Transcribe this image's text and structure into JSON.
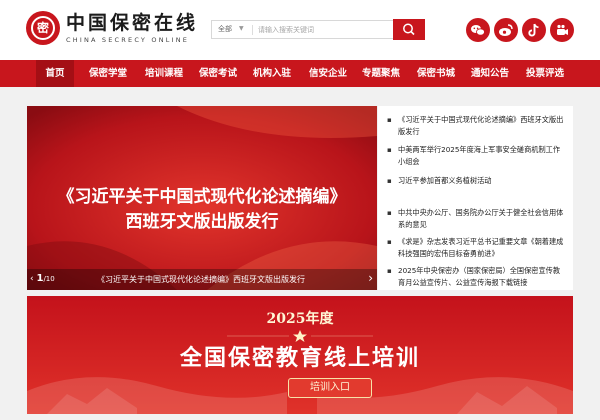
{
  "header": {
    "logo_cn": "中国保密在线",
    "logo_en": "CHINA SECRECY ONLINE",
    "logo_mark": "密",
    "search": {
      "scope": "全部",
      "placeholder": "请输入搜索关键词",
      "button_icon": "search-icon"
    },
    "social_icons": [
      "wechat-icon",
      "weibo-icon",
      "douyin-icon",
      "kuaishou-icon"
    ]
  },
  "nav": {
    "items": [
      "首页",
      "保密学堂",
      "培训课程",
      "保密考试",
      "机构入驻",
      "信安企业",
      "专题聚焦",
      "保密书城",
      "通知公告",
      "投票评选"
    ],
    "active_index": 0
  },
  "carousel": {
    "slide_title_line1": "《习近平关于中国式现代化论述摘编》",
    "slide_title_line2": "西班牙文版出版发行",
    "counter_current": "1",
    "counter_total": "/10",
    "caption": "《习近平关于中国式现代化论述摘编》西班牙文版出版发行"
  },
  "news": [
    "《习近平关于中国式现代化论述摘编》西班牙文版出版发行",
    "中美两军举行2025年度海上军事安全磋商机制工作小组会",
    "习近平参加首都义务植树活动",
    "中共中央办公厅、国务院办公厅关于健全社会信用体系的意见",
    "《求是》杂志发表习近平总书记重要文章《朝着建成科技强国的宏伟目标奋勇前进》",
    "2025年中央保密办（国家保密局）全国保密宣传教育月公益宣传片、公益宣传海报下载链接"
  ],
  "banner": {
    "year": "2025年度",
    "title": "全国保密教育线上培训",
    "button": "培训入口"
  },
  "colors": {
    "brand_red": "#c8161d",
    "nav_active": "#a40f15"
  }
}
